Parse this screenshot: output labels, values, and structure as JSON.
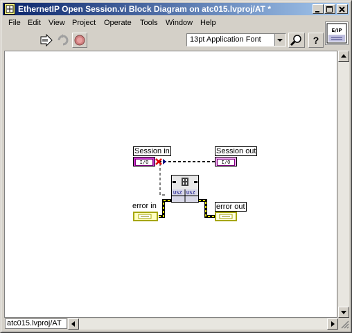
{
  "window": {
    "title": "EthernetIP Open Session.vi Block Diagram on atc015.lvproj/AT *"
  },
  "menubar": {
    "items": [
      {
        "label": "File"
      },
      {
        "label": "Edit"
      },
      {
        "label": "View"
      },
      {
        "label": "Project"
      },
      {
        "label": "Operate"
      },
      {
        "label": "Tools"
      },
      {
        "label": "Window"
      },
      {
        "label": "Help"
      }
    ]
  },
  "toolbar": {
    "font_value": "13pt Application Font"
  },
  "context_icon": {
    "text": "E/IP"
  },
  "diagram": {
    "session_in_label": "Session in",
    "session_in_terminal": "I/O",
    "session_out_label": "Session out",
    "session_out_terminal": "I/O",
    "error_in_label": "error in",
    "error_out_label": "error out",
    "subvi_left_top": "USZ",
    "subvi_right_top": "USZ"
  },
  "status": {
    "path": "atc015.lvproj/AT"
  },
  "colors": {
    "title_start": "#0a246a",
    "title_end": "#a6caf0",
    "io_wire": "#3a003a",
    "error_wire": "#a6a600",
    "session_terminal": "#cc33cc"
  }
}
